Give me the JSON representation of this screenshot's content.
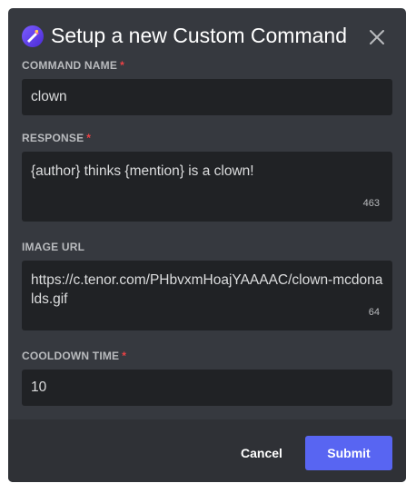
{
  "modal": {
    "title": "Setup a new Custom Command",
    "close_icon": "close-icon",
    "logo_icon": "app-logo-icon"
  },
  "fields": {
    "command_name": {
      "label": "COMMAND NAME",
      "required_marker": "*",
      "value": "clown"
    },
    "response": {
      "label": "RESPONSE",
      "required_marker": "*",
      "value": "{author} thinks {mention} is a clown!",
      "remaining_chars": "463"
    },
    "image_url": {
      "label": "IMAGE URL",
      "value": "https://c.tenor.com/PHbvxmHoajYAAAAC/clown-mcdonalds.gif",
      "remaining_chars": "64"
    },
    "cooldown_time": {
      "label": "COOLDOWN TIME",
      "required_marker": "*",
      "value": "10"
    }
  },
  "footer": {
    "cancel_label": "Cancel",
    "submit_label": "Submit"
  },
  "colors": {
    "modal_bg": "#36393f",
    "footer_bg": "#2f3136",
    "input_bg": "#202225",
    "accent": "#5865f2",
    "required": "#ed4245"
  }
}
